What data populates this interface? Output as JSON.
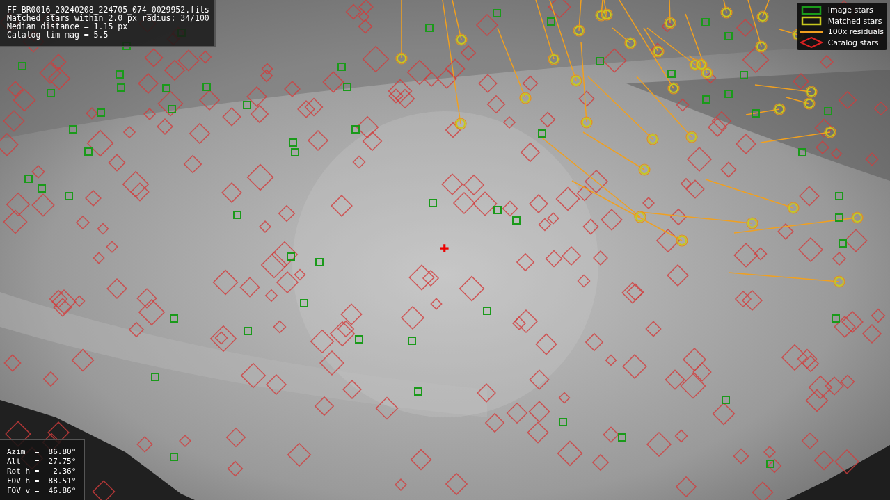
{
  "image_info": {
    "lines": [
      "FF_BR0016_20240208_224705_074_0029952.fits",
      "Matched stars within 2.0 px radius: 34/100",
      "Median distance = 1.15 px",
      "Catalog lim mag = 5.5"
    ]
  },
  "legend": {
    "items": [
      {
        "label": "Image stars"
      },
      {
        "kind": "matched",
        "label": "Matched stars"
      },
      {
        "kind": "residual",
        "label": "100x residuals"
      },
      {
        "kind": "catalog",
        "label": "Catalog stars"
      }
    ]
  },
  "center_mark": "✚",
  "pointing": {
    "rows": [
      "Azim  =  86.80°",
      "Alt   =  27.75°",
      "Rot h =   2.36°",
      "FOV h =  88.51°",
      "FOV v =  46.86°"
    ]
  }
}
